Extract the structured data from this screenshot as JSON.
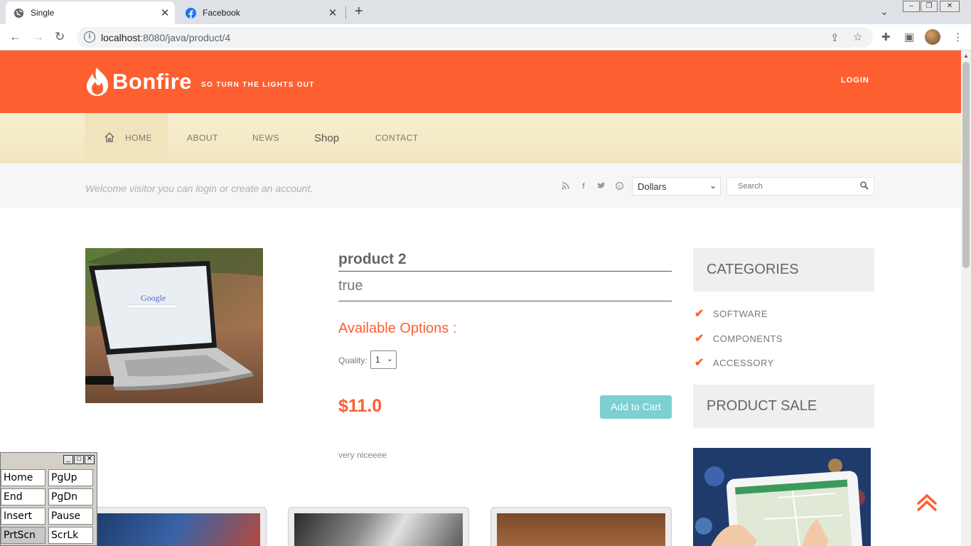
{
  "browser": {
    "tabs": [
      {
        "title": "Single",
        "active": true
      },
      {
        "title": "Facebook",
        "active": false
      }
    ],
    "url_host": "localhost",
    "url_path": ":8080/java/product/4"
  },
  "site": {
    "logo": "Bonfire",
    "tagline": "SO TURN THE LIGHTS OUT",
    "login": "LOGIN",
    "nav": [
      "HOME",
      "ABOUT",
      "NEWS",
      "Shop",
      "CONTACT"
    ],
    "welcome": "Welcome visitor you can login or create an account.",
    "currency": "Dollars",
    "search_placeholder": "Search"
  },
  "product": {
    "title": "product 2",
    "subtitle": "true",
    "available_options": "Available Options :",
    "quality_label": "Quality:",
    "quality_value": "1",
    "price": "$11.0",
    "add_to_cart": "Add to Cart",
    "description": "very niceeee"
  },
  "sidebar": {
    "categories_title": "CATEGORIES",
    "categories": [
      "SOFTWARE",
      "COMPONENTS",
      "ACCESSORY"
    ],
    "sale_title": "PRODUCT SALE"
  },
  "osk": {
    "keys": [
      "Home",
      "PgUp",
      "End",
      "PgDn",
      "Insert",
      "Pause",
      "PrtScn",
      "ScrLk"
    ]
  },
  "colors": {
    "brand": "#fe5f30",
    "cart": "#7ecfd1"
  }
}
